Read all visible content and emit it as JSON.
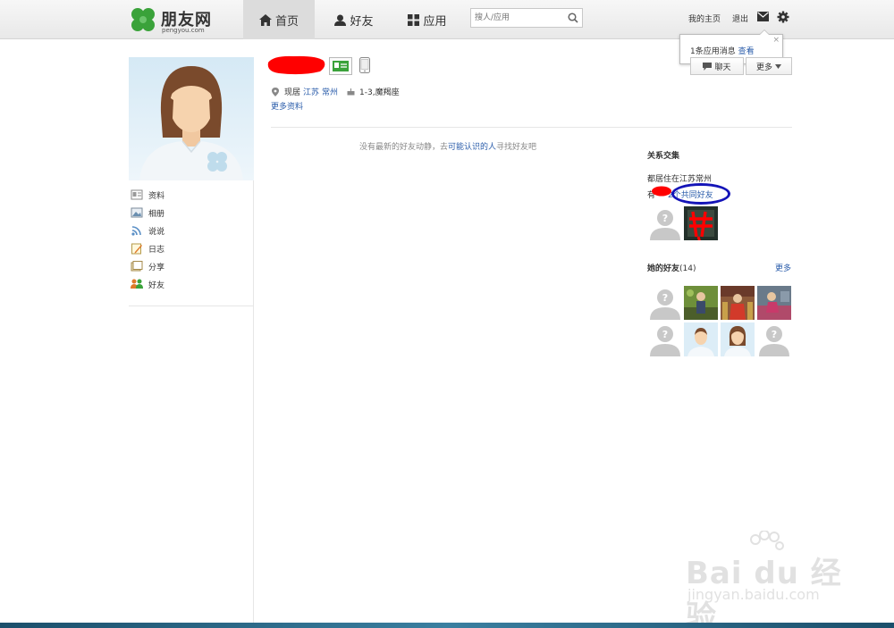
{
  "header": {
    "logo_text": "朋友网",
    "logo_domain": "pengyou.com",
    "nav": [
      {
        "label": "首页",
        "icon": "home-icon"
      },
      {
        "label": "好友",
        "icon": "person-icon"
      },
      {
        "label": "应用",
        "icon": "apps-icon"
      }
    ],
    "search_placeholder": "搜人/应用",
    "my_home": "我的主页",
    "logout": "退出"
  },
  "notification": {
    "text": "1条应用消息",
    "link": "查看"
  },
  "sidebar": {
    "items": [
      {
        "label": "资料",
        "icon": "profile-card-icon"
      },
      {
        "label": "相册",
        "icon": "photo-album-icon"
      },
      {
        "label": "说说",
        "icon": "rss-icon"
      },
      {
        "label": "日志",
        "icon": "diary-icon"
      },
      {
        "label": "分享",
        "icon": "share-icon"
      },
      {
        "label": "好友",
        "icon": "friends-icon"
      }
    ]
  },
  "profile": {
    "location_label": "现居",
    "province": "江苏",
    "city": "常州",
    "birthday": "1-3,魔羯座",
    "more_info": "更多资料",
    "chat_button": "聊天",
    "more_button": "更多"
  },
  "feed": {
    "empty_prefix": "没有最新的好友动静，去",
    "empty_link": "可能认识的人",
    "empty_suffix": "寻找好友吧"
  },
  "relations": {
    "title": "关系交集",
    "live_in": "都居住在江苏常州",
    "common_prefix": "有",
    "common_link": "2个共同好友"
  },
  "friends": {
    "title_prefix": "她的好友",
    "count": "(14)",
    "more": "更多"
  },
  "watermark": {
    "text": "Bai du 经验",
    "url": "jingyan.baidu.com"
  },
  "colors": {
    "link": "#2a5caa",
    "brand_green": "#3aa23a",
    "annotation_red": "#ff0000",
    "annotation_blue": "#1414b8"
  }
}
